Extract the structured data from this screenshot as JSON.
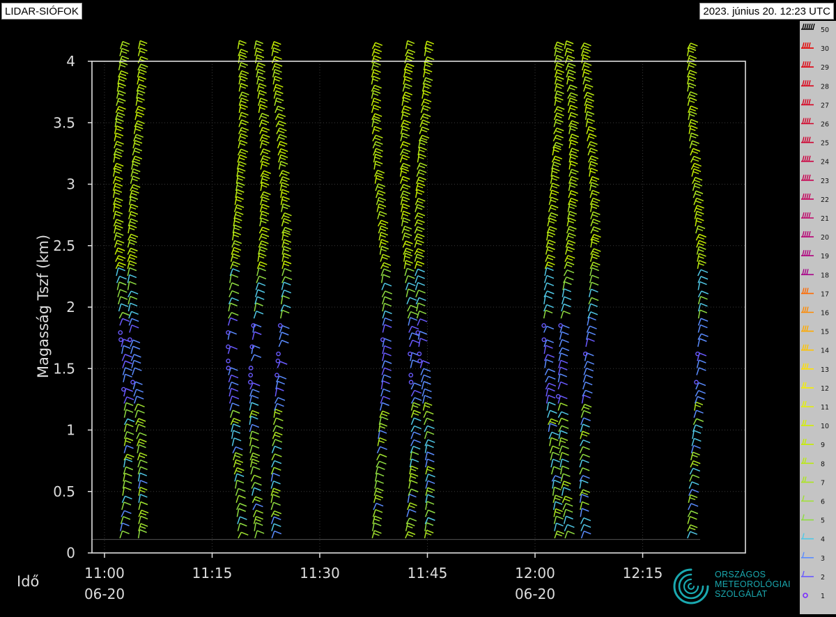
{
  "header": {
    "station": "LIDAR-SIÓFOK",
    "timestamp": "2023. június 20. 12:23 UTC"
  },
  "logo": {
    "lines": [
      "ORSZÁGOS",
      "METEOROLÓGIAI",
      "SZOLGÁLAT"
    ],
    "color": "#1aa9b0"
  },
  "chart_data": {
    "type": "wind-barb time-height profile",
    "ylabel": "Magasság Tszf (km)",
    "xlabel": "Idő",
    "ylim": [
      0,
      4
    ],
    "yticks": [
      "0",
      "0.5",
      "1",
      "1.5",
      "2",
      "2.5",
      "3",
      "3.5",
      "4"
    ],
    "xlim_minutes": [
      -3,
      69
    ],
    "xticks": [
      {
        "minute": 0,
        "label": "11:00",
        "date": "06-20"
      },
      {
        "minute": 15,
        "label": "11:15",
        "date": ""
      },
      {
        "minute": 30,
        "label": "11:30",
        "date": ""
      },
      {
        "minute": 45,
        "label": "11:45",
        "date": ""
      },
      {
        "minute": 60,
        "label": "12:00",
        "date": "06-20"
      },
      {
        "minute": 75,
        "label": "12:15",
        "date": ""
      }
    ],
    "grid": true,
    "profile_times_minutes": [
      2,
      4,
      18,
      21,
      24,
      38,
      42,
      44,
      62,
      64,
      67,
      82
    ],
    "profile_top_km": 4.1,
    "profile_bottom_km": 0.12,
    "speed_legend": {
      "position": "right",
      "levels": [
        {
          "label": "50",
          "color": "#000000"
        },
        {
          "label": "30",
          "color": "#e60000"
        },
        {
          "label": "29",
          "color": "#e00010"
        },
        {
          "label": "28",
          "color": "#dc0018"
        },
        {
          "label": "27",
          "color": "#d80020"
        },
        {
          "label": "26",
          "color": "#d40028"
        },
        {
          "label": "25",
          "color": "#d00030"
        },
        {
          "label": "24",
          "color": "#cc0040"
        },
        {
          "label": "23",
          "color": "#c80050"
        },
        {
          "label": "22",
          "color": "#c4005c"
        },
        {
          "label": "21",
          "color": "#be0068"
        },
        {
          "label": "20",
          "color": "#b80074"
        },
        {
          "label": "19",
          "color": "#b0007e"
        },
        {
          "label": "18",
          "color": "#a80088"
        },
        {
          "label": "17",
          "color": "#ff6a00"
        },
        {
          "label": "16",
          "color": "#ff8a00"
        },
        {
          "label": "15",
          "color": "#ffaa00"
        },
        {
          "label": "14",
          "color": "#ffc400"
        },
        {
          "label": "13",
          "color": "#ffe000"
        },
        {
          "label": "12",
          "color": "#f5f000"
        },
        {
          "label": "11",
          "color": "#e6f200"
        },
        {
          "label": "10",
          "color": "#d4f000"
        },
        {
          "label": "9",
          "color": "#c6ee00"
        },
        {
          "label": "8",
          "color": "#baea10"
        },
        {
          "label": "7",
          "color": "#ade620"
        },
        {
          "label": "6",
          "color": "#a0e230"
        },
        {
          "label": "5",
          "color": "#8fdc40"
        },
        {
          "label": "4",
          "color": "#50c8e6"
        },
        {
          "label": "3",
          "color": "#5a8cff"
        },
        {
          "label": "2",
          "color": "#6a5aff"
        },
        {
          "label": "1",
          "color": "#7a2cff"
        }
      ]
    }
  }
}
